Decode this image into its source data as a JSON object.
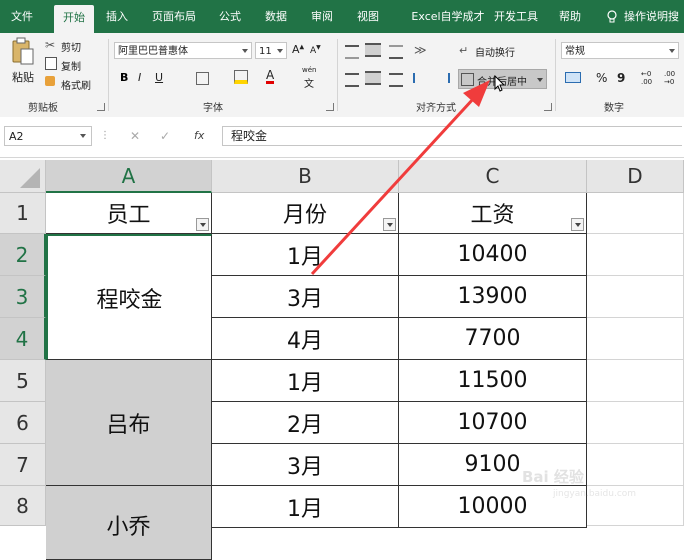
{
  "ribbon": {
    "tabs": [
      "文件",
      "开始",
      "插入",
      "页面布局",
      "公式",
      "数据",
      "审阅",
      "视图",
      "Excel自学成才",
      "开发工具",
      "帮助"
    ],
    "active_tab": "开始",
    "tell_me": "操作说明搜",
    "clipboard": {
      "paste": "粘贴",
      "cut": "剪切",
      "copy": "复制",
      "format_painter": "格式刷",
      "label": "剪贴板"
    },
    "font": {
      "font_name": "阿里巴巴普惠体",
      "font_size": "11",
      "bold": "B",
      "italic": "I",
      "underline": "U",
      "label": "字体",
      "wen": "wén",
      "wen_char": "文"
    },
    "alignment": {
      "wrap_text": "自动换行",
      "merge_center": "合并后居中",
      "label": "对齐方式"
    },
    "number": {
      "format": "常规",
      "percent": "%",
      "comma": "9",
      "inc_decimal": "←0 .00",
      "dec_decimal": ".00 →0",
      "label": "数字"
    }
  },
  "formula_bar": {
    "name_box": "A2",
    "fx": "fx",
    "cancel": "✕",
    "enter": "✓",
    "content": "程咬金"
  },
  "sheet": {
    "columns": [
      "A",
      "B",
      "C",
      "D"
    ],
    "rows": [
      "1",
      "2",
      "3",
      "4",
      "5",
      "6",
      "7",
      "8"
    ],
    "headers": [
      "员工",
      "月份",
      "工资"
    ],
    "merged_a": [
      "程咬金",
      "吕布",
      "小乔"
    ],
    "b_values": [
      "1月",
      "3月",
      "4月",
      "1月",
      "2月",
      "3月",
      "1月"
    ],
    "c_values": [
      "10400",
      "13900",
      "7700",
      "11500",
      "10700",
      "9100",
      "10000"
    ]
  },
  "watermark": {
    "text": "Bai 经验",
    "sub": "jingyan.baidu.com"
  },
  "colors": {
    "excel_green": "#217346",
    "arrow_red": "#f03c3c",
    "merged_gray": "#d0d0d0"
  }
}
